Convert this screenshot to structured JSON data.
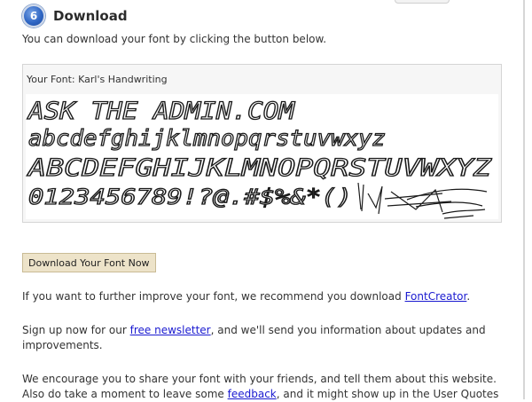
{
  "step": {
    "number": "6",
    "title": "Download"
  },
  "intro_text": "You can download your font by clicking the button below.",
  "preview": {
    "label": "Your Font: Karl's Handwriting",
    "lines": [
      "ASK THE ADMIN.COM",
      "abcdefghijklmnopqrstuvwxyz",
      "ABCDEFGHIJKLMNOPQRSTUVWXYZ",
      "0123456789!?@.#$%&*()"
    ]
  },
  "download_button_label": "Download Your Font Now",
  "paragraphs": {
    "improve": {
      "before": "If you want to further improve your font, we recommend you download ",
      "link": "FontCreator",
      "after": "."
    },
    "newsletter": {
      "before": "Sign up now for our ",
      "link": "free newsletter",
      "after": ", and we'll send you information about updates and improvements."
    },
    "share": {
      "line1": "We encourage you to share your font with your friends, and tell them about this website.",
      "before": "Also do take a moment to leave some ",
      "link": "feedback",
      "after": ", and it might show up in the User Quotes"
    }
  },
  "colors": {
    "link": "#1a1ad0",
    "badge": "#2f66c4",
    "button_bg": "#ede3c9"
  }
}
